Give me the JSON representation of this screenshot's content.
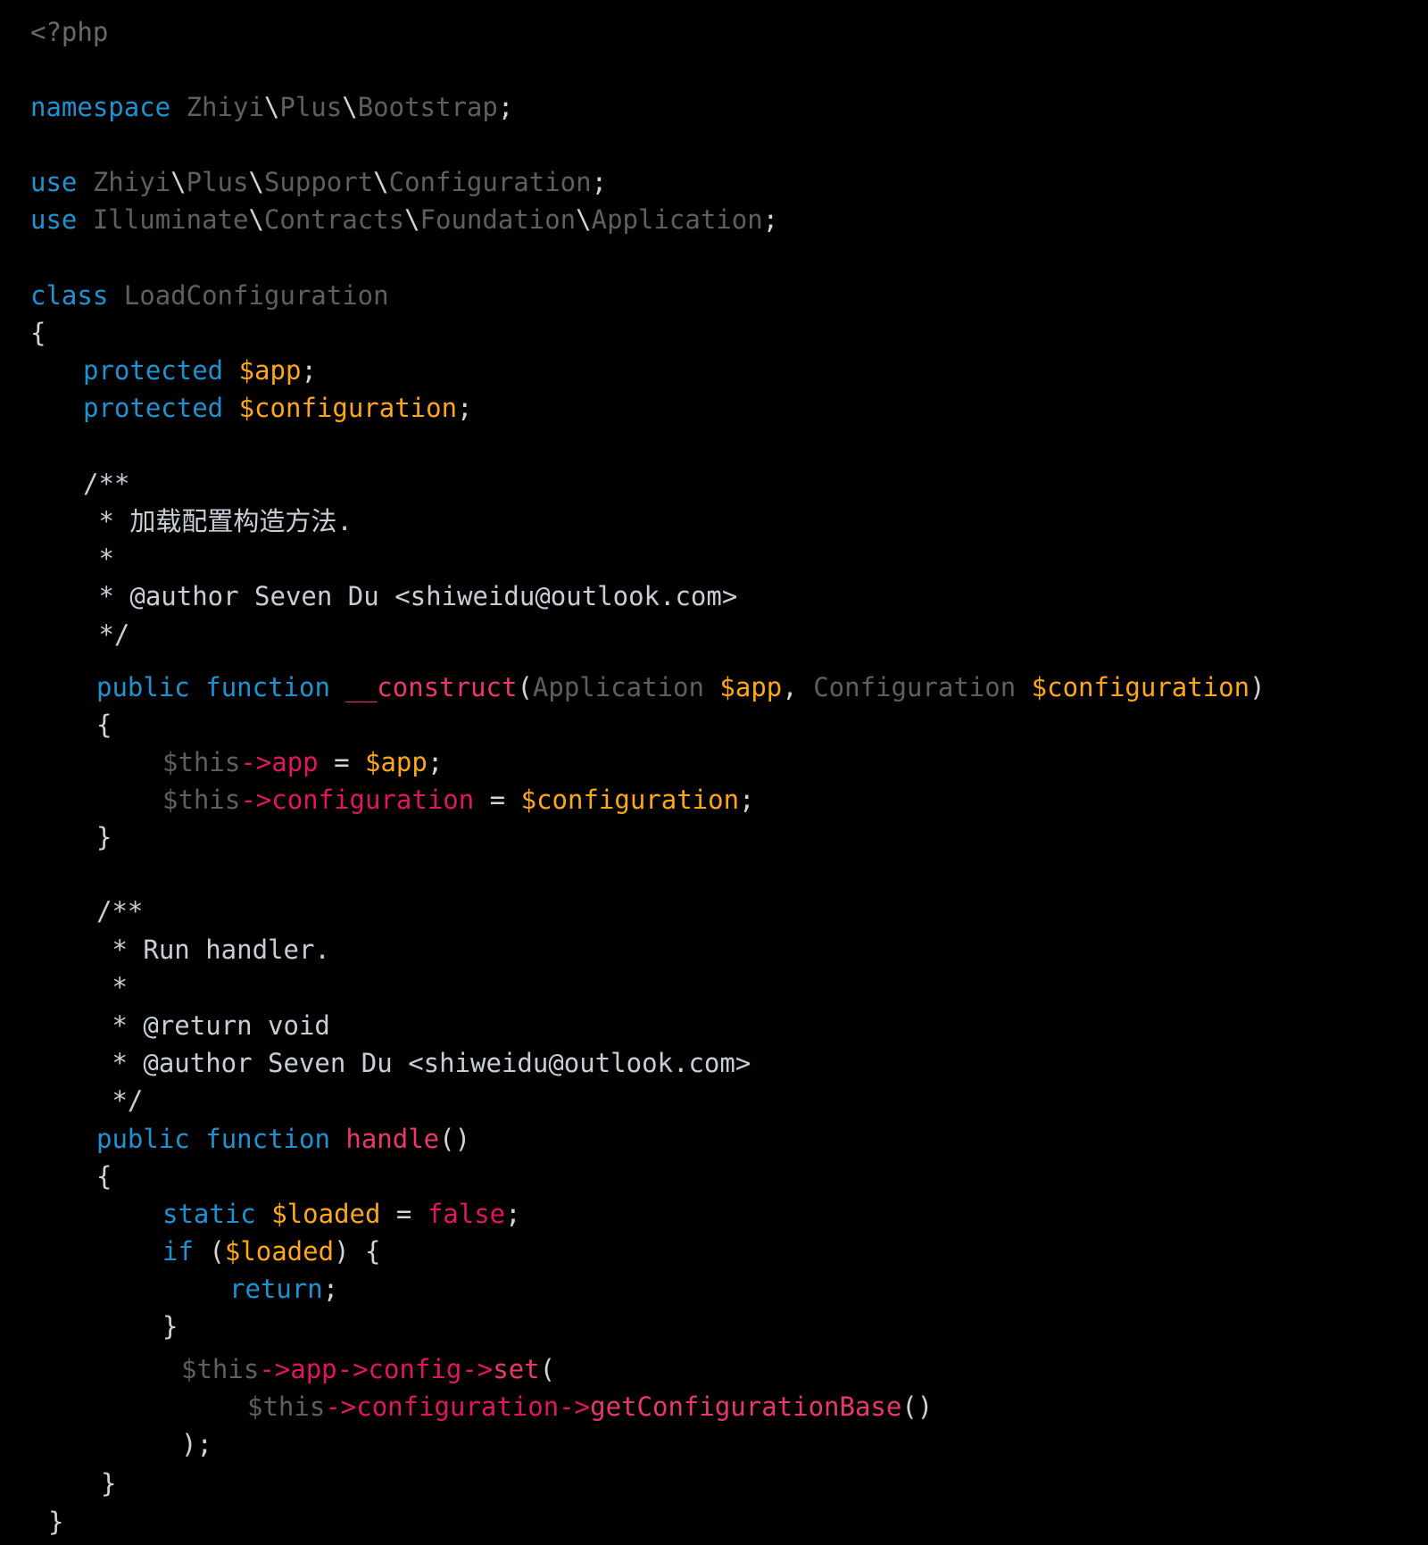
{
  "editor": {
    "theme": {
      "background": "#000000",
      "keyword": "#1f93d1",
      "identifier": "#5f5f5f",
      "variable": "#ffa719",
      "property": "#e0175f",
      "function": "#e9386a",
      "punctuation": "#d4d4d4",
      "comment": "#c9ced6"
    },
    "lines": [
      {
        "tokens": [
          {
            "t": "<?php",
            "c": "dim"
          }
        ]
      },
      {
        "tokens": [
          {
            "t": "namespace",
            "c": "kw"
          },
          {
            "t": " Zhiyi",
            "c": "id"
          },
          {
            "t": "\\",
            "c": "punc"
          },
          {
            "t": "Plus",
            "c": "id"
          },
          {
            "t": "\\",
            "c": "punc"
          },
          {
            "t": "Bootstrap",
            "c": "id"
          },
          {
            "t": ";",
            "c": "punc"
          }
        ]
      },
      {
        "tokens": [
          {
            "t": "use",
            "c": "kw"
          },
          {
            "t": " Zhiyi",
            "c": "id"
          },
          {
            "t": "\\",
            "c": "punc"
          },
          {
            "t": "Plus",
            "c": "id"
          },
          {
            "t": "\\",
            "c": "punc"
          },
          {
            "t": "Support",
            "c": "id"
          },
          {
            "t": "\\",
            "c": "punc"
          },
          {
            "t": "Configuration",
            "c": "id"
          },
          {
            "t": ";",
            "c": "punc"
          }
        ]
      },
      {
        "tokens": [
          {
            "t": "use",
            "c": "kw"
          },
          {
            "t": " Illuminate",
            "c": "id"
          },
          {
            "t": "\\",
            "c": "punc"
          },
          {
            "t": "Contracts",
            "c": "id"
          },
          {
            "t": "\\",
            "c": "punc"
          },
          {
            "t": "Foundation",
            "c": "id"
          },
          {
            "t": "\\",
            "c": "punc"
          },
          {
            "t": "Application",
            "c": "id"
          },
          {
            "t": ";",
            "c": "punc"
          }
        ]
      },
      {
        "tokens": [
          {
            "t": "class",
            "c": "kw"
          },
          {
            "t": " LoadConfiguration",
            "c": "id"
          }
        ]
      },
      {
        "tokens": [
          {
            "t": "{",
            "c": "punc"
          }
        ]
      },
      {
        "tokens": [
          {
            "t": "protected",
            "c": "kw"
          },
          {
            "t": " $app",
            "c": "var"
          },
          {
            "t": ";",
            "c": "punc"
          }
        ]
      },
      {
        "tokens": [
          {
            "t": "protected",
            "c": "kw"
          },
          {
            "t": " $configuration",
            "c": "var"
          },
          {
            "t": ";",
            "c": "punc"
          }
        ]
      },
      {
        "tokens": [
          {
            "t": "/**",
            "c": "cmt"
          }
        ]
      },
      {
        "tokens": [
          {
            "t": " * 加载配置构造方法.",
            "c": "cmt"
          }
        ]
      },
      {
        "tokens": [
          {
            "t": " *",
            "c": "cmt"
          }
        ]
      },
      {
        "tokens": [
          {
            "t": " * @author Seven Du <shiweidu@outlook.com>",
            "c": "cmt"
          }
        ]
      },
      {
        "tokens": [
          {
            "t": " */",
            "c": "cmt"
          }
        ]
      },
      {
        "tokens": [
          {
            "t": "public",
            "c": "kw"
          },
          {
            "t": " ",
            "c": "punc"
          },
          {
            "t": "function",
            "c": "kw"
          },
          {
            "t": " __construct",
            "c": "fn"
          },
          {
            "t": "(",
            "c": "punc"
          },
          {
            "t": "Application",
            "c": "id"
          },
          {
            "t": " $app",
            "c": "var"
          },
          {
            "t": ", ",
            "c": "punc"
          },
          {
            "t": "Configuration",
            "c": "id"
          },
          {
            "t": " $configuration",
            "c": "var"
          },
          {
            "t": ")",
            "c": "punc"
          }
        ]
      },
      {
        "tokens": [
          {
            "t": "{",
            "c": "punc"
          }
        ]
      },
      {
        "tokens": [
          {
            "t": "$this",
            "c": "id"
          },
          {
            "t": "->",
            "c": "prop"
          },
          {
            "t": "app",
            "c": "prop"
          },
          {
            "t": " = ",
            "c": "punc"
          },
          {
            "t": "$app",
            "c": "var"
          },
          {
            "t": ";",
            "c": "punc"
          }
        ]
      },
      {
        "tokens": [
          {
            "t": "$this",
            "c": "id"
          },
          {
            "t": "->",
            "c": "prop"
          },
          {
            "t": "configuration",
            "c": "prop"
          },
          {
            "t": " = ",
            "c": "punc"
          },
          {
            "t": "$configuration",
            "c": "var"
          },
          {
            "t": ";",
            "c": "punc"
          }
        ]
      },
      {
        "tokens": [
          {
            "t": "}",
            "c": "punc"
          }
        ]
      },
      {
        "tokens": [
          {
            "t": "/**",
            "c": "cmt"
          }
        ]
      },
      {
        "tokens": [
          {
            "t": " * Run handler.",
            "c": "cmt"
          }
        ]
      },
      {
        "tokens": [
          {
            "t": " *",
            "c": "cmt"
          }
        ]
      },
      {
        "tokens": [
          {
            "t": " * @return void",
            "c": "cmt"
          }
        ]
      },
      {
        "tokens": [
          {
            "t": " * @author Seven Du <shiweidu@outlook.com>",
            "c": "cmt"
          }
        ]
      },
      {
        "tokens": [
          {
            "t": " */",
            "c": "cmt"
          }
        ]
      },
      {
        "tokens": [
          {
            "t": "public",
            "c": "kw"
          },
          {
            "t": " ",
            "c": "punc"
          },
          {
            "t": "function",
            "c": "kw"
          },
          {
            "t": " handle",
            "c": "fn"
          },
          {
            "t": "()",
            "c": "punc"
          }
        ]
      },
      {
        "tokens": [
          {
            "t": "{",
            "c": "punc"
          }
        ]
      },
      {
        "tokens": [
          {
            "t": "static",
            "c": "kw"
          },
          {
            "t": " $loaded",
            "c": "var"
          },
          {
            "t": " = ",
            "c": "punc"
          },
          {
            "t": "false",
            "c": "prop"
          },
          {
            "t": ";",
            "c": "punc"
          }
        ]
      },
      {
        "tokens": [
          {
            "t": "if",
            "c": "kw"
          },
          {
            "t": " (",
            "c": "punc"
          },
          {
            "t": "$loaded",
            "c": "var"
          },
          {
            "t": ") {",
            "c": "punc"
          }
        ]
      },
      {
        "tokens": [
          {
            "t": "return",
            "c": "kw"
          },
          {
            "t": ";",
            "c": "punc"
          }
        ]
      },
      {
        "tokens": [
          {
            "t": "}",
            "c": "punc"
          }
        ]
      },
      {
        "tokens": [
          {
            "t": "$this",
            "c": "id"
          },
          {
            "t": "->",
            "c": "prop"
          },
          {
            "t": "app",
            "c": "prop"
          },
          {
            "t": "->",
            "c": "prop"
          },
          {
            "t": "config",
            "c": "prop"
          },
          {
            "t": "->",
            "c": "prop"
          },
          {
            "t": "set",
            "c": "fn"
          },
          {
            "t": "(",
            "c": "punc"
          }
        ]
      },
      {
        "tokens": [
          {
            "t": "$this",
            "c": "id"
          },
          {
            "t": "->",
            "c": "prop"
          },
          {
            "t": "configuration",
            "c": "prop"
          },
          {
            "t": "->",
            "c": "prop"
          },
          {
            "t": "getConfigurationBase",
            "c": "fn"
          },
          {
            "t": "()",
            "c": "punc"
          }
        ]
      },
      {
        "tokens": [
          {
            "t": ");",
            "c": "punc"
          }
        ]
      },
      {
        "tokens": [
          {
            "t": "}",
            "c": "punc"
          }
        ]
      },
      {
        "tokens": [
          {
            "t": "}",
            "c": "punc"
          }
        ]
      }
    ]
  }
}
